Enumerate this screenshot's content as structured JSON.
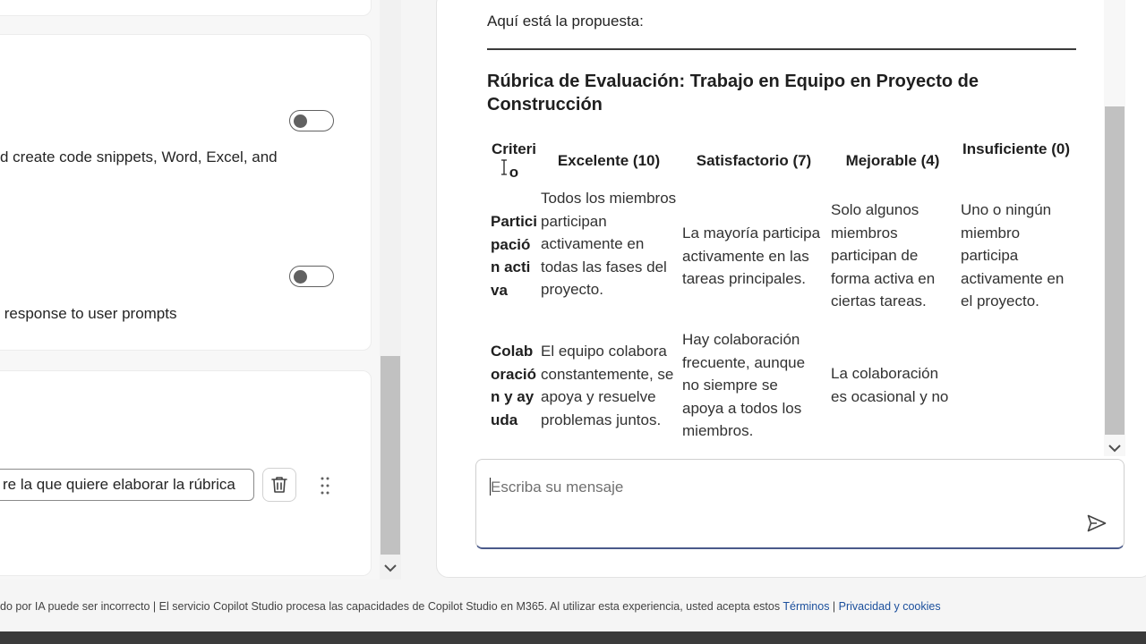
{
  "settings": {
    "code_interpreter_desc": "d create code snippets, Word, Excel, and",
    "response_desc": " response to user prompts"
  },
  "prompt": {
    "chip_text": "re la que quiere elaborar la rúbrica"
  },
  "chat": {
    "intro": "Aquí está la propuesta:",
    "rubric_title": "Rúbrica de Evaluación: Trabajo en Equipo en Proyecto de Construcción",
    "table": {
      "headers": [
        "Criterio",
        "Excelente (10)",
        "Satisfactorio (7)",
        "Mejorable (4)",
        "Insuficiente (0)"
      ],
      "rows": [
        {
          "criterion": "Participación activa",
          "cells": [
            "Todos los miembros participan activamente en todas las fases del proyecto.",
            "La mayoría participa activamente en las tareas principales.",
            "Solo algunos miembros participan de forma activa en ciertas tareas.",
            "Uno o ningún miembro participa activamente en el proyecto."
          ]
        },
        {
          "criterion": "Colaboración y ayuda",
          "cells": [
            "El equipo colabora constantemente, se apoya y resuelve problemas juntos.",
            "Hay colaboración frecuente, aunque no siempre se apoya a todos los miembros.",
            "La colaboración es ocasional y no",
            ""
          ]
        }
      ]
    }
  },
  "composer": {
    "placeholder": "Escriba su mensaje"
  },
  "footer": {
    "text": "do por IA puede ser incorrecto | El servicio Copilot Studio procesa las capacidades de Copilot Studio en M365. Al utilizar esta experiencia, usted acepta estos ",
    "terms_link": "Términos",
    "separator": " | ",
    "privacy_link": "Privacidad y cookies"
  },
  "icons": {
    "toggle_off": "toggle-switch",
    "delete": "trash-icon",
    "drag": "drag-handle-icon",
    "send": "send-icon",
    "scroll_down": "chevron-down-icon"
  },
  "colors": {
    "link": "#1b4f9c",
    "composer_focus": "#4a5a8a",
    "scroll_thumb": "#c1c1c1"
  }
}
